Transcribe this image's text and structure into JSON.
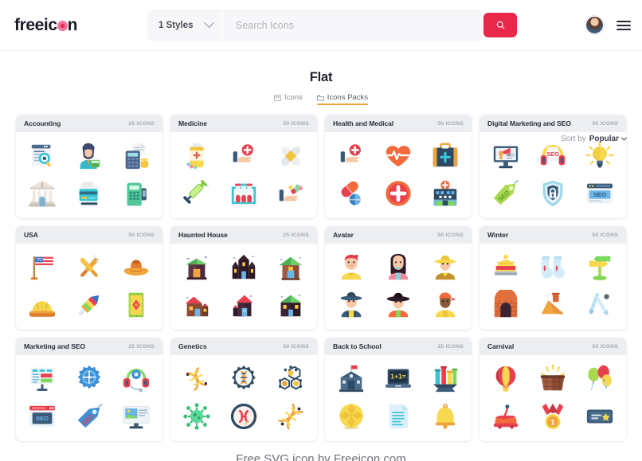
{
  "header": {
    "logo_text_a": "freeic",
    "logo_text_b": "n",
    "styles_label": "1 Styles",
    "search_placeholder": "Search Icons",
    "search_value": "",
    "search_button_icon": "search-icon",
    "accent_color": "#e8274b",
    "avatar_icon": "user-avatar",
    "menu_icon": "hamburger-menu-icon"
  },
  "main": {
    "title": "Flat",
    "tabs": [
      {
        "label": "Icons",
        "icon": "grid-icon",
        "active": false
      },
      {
        "label": "Icons Packs",
        "icon": "packs-icon",
        "active": true
      }
    ],
    "sort": {
      "label": "Sort by",
      "value": "Popular",
      "caret_icon": "chevron-down-icon"
    },
    "count_suffix": "ICONS",
    "packs": [
      {
        "title": "Accounting",
        "count": "25 ICONS",
        "icons": [
          "invoice-search",
          "accountant-woman",
          "card-reader-coins",
          "bank-building",
          "credit-card",
          "pos-terminal"
        ]
      },
      {
        "title": "Medicine",
        "count": "50 ICONS",
        "icons": [
          "pill-bottle",
          "hand-medical-cross",
          "bandage-cross",
          "syringe",
          "test-tube-rack",
          "hand-pills"
        ]
      },
      {
        "title": "Health and Medical",
        "count": "50 ICONS",
        "icons": [
          "hand-medical-cross",
          "heartbeat",
          "first-aid-kit",
          "capsule-pills",
          "medical-cross-circle",
          "hospital-building"
        ]
      },
      {
        "title": "Digital Marketing and SEO",
        "count": "50 ICONS",
        "icons": [
          "monitor-megaphone",
          "seo-headphones",
          "lightbulb-idea",
          "seo-tag",
          "security-lock-shield",
          "seo-browser"
        ]
      },
      {
        "title": "USA",
        "count": "50 ICONS",
        "icons": [
          "usa-flag",
          "baseball-bats",
          "cowboy-hat",
          "apple-pie",
          "firework-rocket",
          "native-rug"
        ]
      },
      {
        "title": "Haunted House",
        "count": "25 ICONS",
        "icons": [
          "haunted-house-1",
          "haunted-castle",
          "haunted-cabin",
          "haunted-house-2",
          "haunted-tower",
          "haunted-manor"
        ]
      },
      {
        "title": "Avatar",
        "count": "50 ICONS",
        "icons": [
          "avatar-man-beret",
          "avatar-woman-long-hair",
          "avatar-man-straw-hat",
          "avatar-farmer",
          "avatar-woman-hat",
          "avatar-man-cap"
        ]
      },
      {
        "title": "Winter",
        "count": "50 ICONS",
        "icons": [
          "winter-beanie",
          "winter-socks",
          "snow-signpost",
          "fireplace",
          "snow-roof",
          "ski-poles"
        ]
      },
      {
        "title": "Marketing and SEO",
        "count": "25 ICONS",
        "icons": [
          "dashboard-board",
          "gear-target",
          "headset-support",
          "seo-window",
          "seo-price-tag",
          "image-monitor"
        ]
      },
      {
        "title": "Genetics",
        "count": "50 ICONS",
        "icons": [
          "dna-strand",
          "dna-gear",
          "molecule-honeycomb",
          "virus-cell",
          "chromosome-circle",
          "dna-helix"
        ]
      },
      {
        "title": "Back to School",
        "count": "25 ICONS",
        "icons": [
          "school-building",
          "laptop-math",
          "lab-flasks",
          "ball-yellow",
          "notebook-paper",
          "school-bell"
        ]
      },
      {
        "title": "Carnival",
        "count": "50 ICONS",
        "icons": [
          "hot-air-balloon",
          "firework-box",
          "party-balloons",
          "bumper-car",
          "gold-medal",
          "ticket-star"
        ]
      }
    ]
  },
  "footer": {
    "text": "Free SVG icon by Freeicon.com"
  }
}
